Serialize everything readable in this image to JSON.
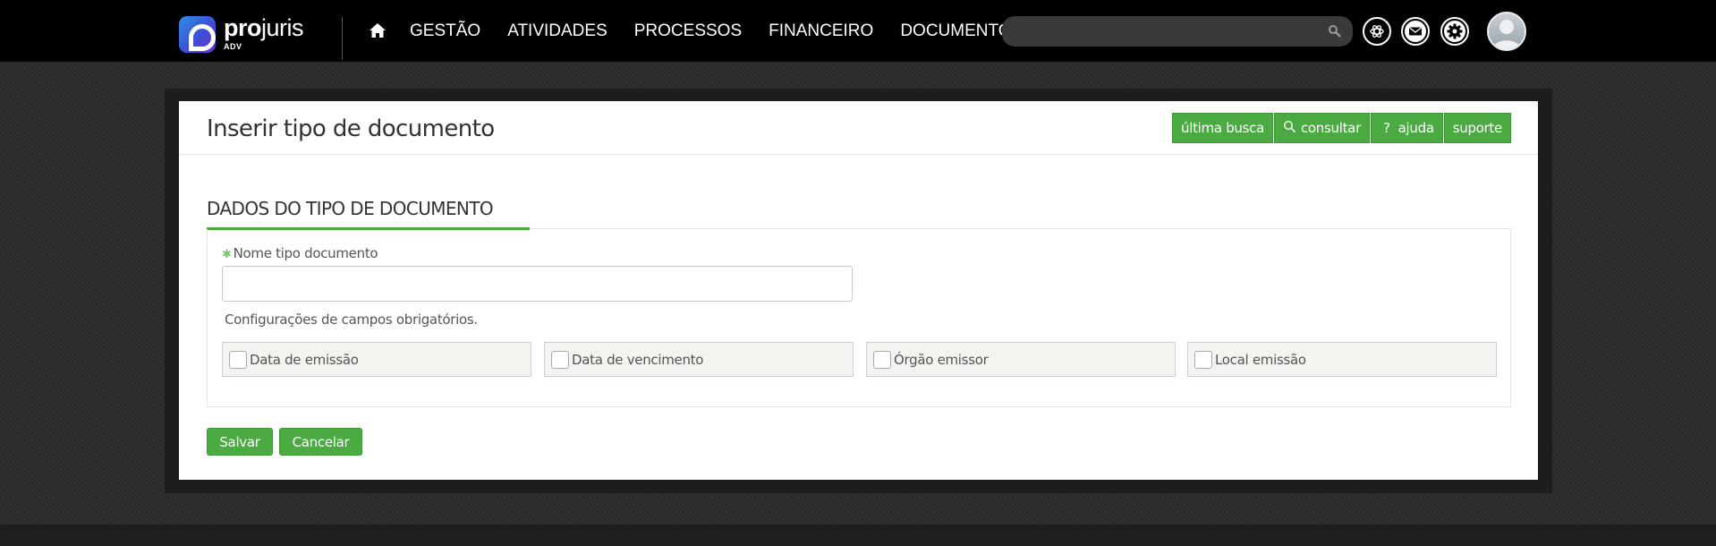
{
  "brand": {
    "name_bold": "pro",
    "name_light": "juris",
    "sub": "ADV"
  },
  "nav": {
    "items": [
      {
        "label": "GESTÃO"
      },
      {
        "label": "ATIVIDADES"
      },
      {
        "label": "PROCESSOS"
      },
      {
        "label": "FINANCEIRO"
      },
      {
        "label": "DOCUMENTOS"
      }
    ]
  },
  "search": {
    "value": "",
    "placeholder": ""
  },
  "page": {
    "title": "Inserir tipo de documento",
    "actions": [
      {
        "label": "última busca",
        "icon": ""
      },
      {
        "label": "consultar",
        "icon": "magnifier-icon"
      },
      {
        "label": "ajuda",
        "icon": "question-icon"
      },
      {
        "label": "suporte",
        "icon": ""
      }
    ]
  },
  "form": {
    "section_title": "DADOS DO TIPO DE DOCUMENTO",
    "name_field": {
      "label": "Nome tipo documento",
      "value": "",
      "required": true
    },
    "hint": "Configurações de campos obrigatórios.",
    "options": [
      {
        "label": "Data de emissão",
        "checked": false
      },
      {
        "label": "Data de vencimento",
        "checked": false
      },
      {
        "label": "Órgão emissor",
        "checked": false
      },
      {
        "label": "Local emissão",
        "checked": false
      }
    ],
    "save_label": "Salvar",
    "cancel_label": "Cancelar"
  },
  "colors": {
    "accent": "#4caa43",
    "topbar": "#000000",
    "background": "#2b2b2b"
  }
}
